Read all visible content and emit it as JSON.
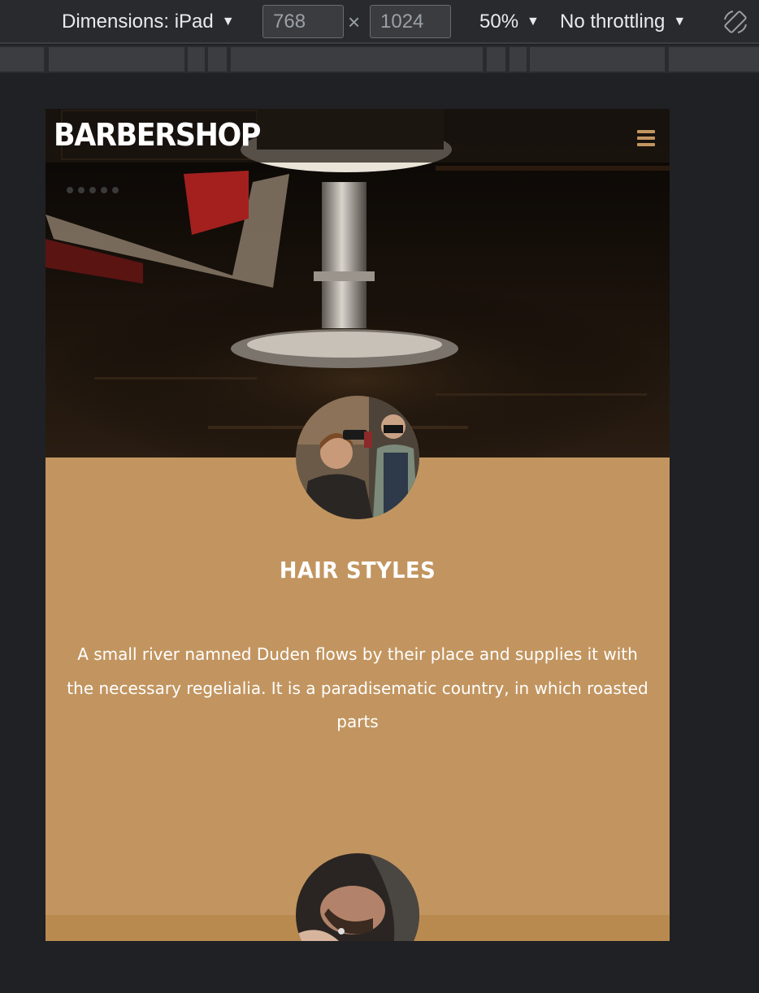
{
  "toolbar": {
    "dimensions_label": "Dimensions: iPad",
    "width_value": "768",
    "height_value": "1024",
    "times_symbol": "×",
    "zoom_label": "50%",
    "throttling_label": "No throttling",
    "caret": "▼",
    "rotate_icon": "rotate-icon"
  },
  "page": {
    "logo": "BARBERSHOP",
    "menu_icon": "hamburger-menu-icon",
    "section_title": "HAIR STYLES",
    "section_text": "A small river namned Duden flows by their place and supplies it with the necessary regelialia. It is a paradisematic country, in which roasted parts"
  },
  "colors": {
    "devtools_bg": "#202124",
    "toolbar_bg": "#292a2d",
    "accent_tan": "#c29560",
    "hero_dark": "#0b0806",
    "chair_red": "#a3201f"
  }
}
